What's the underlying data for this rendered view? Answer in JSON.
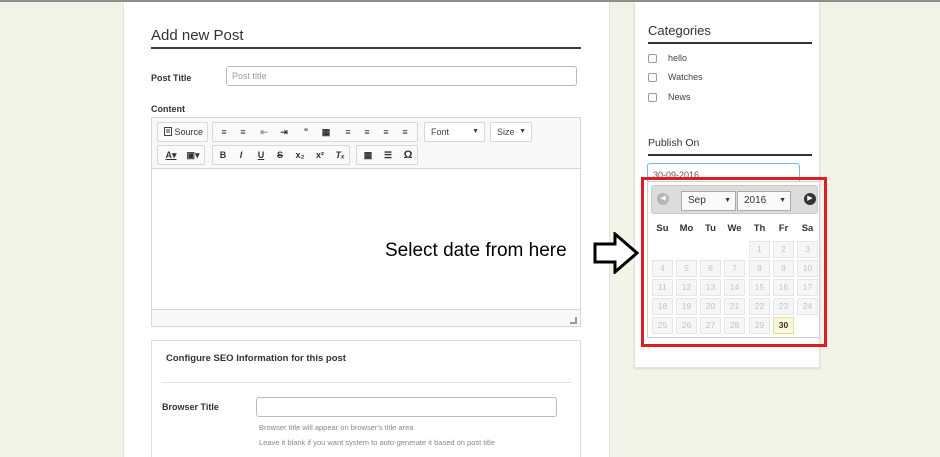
{
  "form": {
    "title": "Add new Post",
    "post_title_label": "Post Title",
    "post_title_placeholder": "Post title",
    "content_label": "Content"
  },
  "editor": {
    "source_label": "Source",
    "font_label": "Font",
    "size_label": "Size"
  },
  "seo": {
    "heading": "Configure SEO Information for this post",
    "browser_title_label": "Browser Title",
    "help_1": "Browser title will appear on browser's title area",
    "help_2": "Leave it blank if you want system to auto-generate it based on post title"
  },
  "sidebar": {
    "categories_title": "Categories",
    "categories": [
      "hello",
      "Watches",
      "News"
    ],
    "publish_title": "Publish On",
    "publish_date": "30-09-2016"
  },
  "datepicker": {
    "month": "Sep",
    "year": "2016",
    "weekdays": [
      "Su",
      "Mo",
      "Tu",
      "We",
      "Th",
      "Fr",
      "Sa"
    ],
    "weeks": [
      [
        "",
        "",
        "",
        "",
        "1",
        "2",
        "3"
      ],
      [
        "4",
        "5",
        "6",
        "7",
        "8",
        "9",
        "10"
      ],
      [
        "11",
        "12",
        "13",
        "14",
        "15",
        "16",
        "17"
      ],
      [
        "18",
        "19",
        "20",
        "21",
        "22",
        "23",
        "24"
      ],
      [
        "25",
        "26",
        "27",
        "28",
        "29",
        "30",
        ""
      ]
    ],
    "selected_day": "30"
  },
  "annotation": {
    "text": "Select date from here"
  },
  "colors": {
    "highlight_frame": "#e01b23",
    "today_bg": "#fcf8d6",
    "page_bg": "#f4f3e8"
  }
}
